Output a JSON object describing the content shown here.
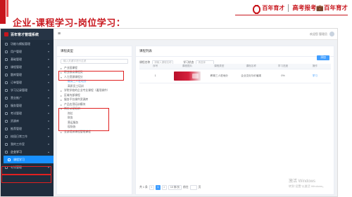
{
  "slide": {
    "title": "企业-课程学习-岗位学习：",
    "brand_name": "百年育才",
    "brand_slogan": "高考报考💼百年育才"
  },
  "app": {
    "title": "百年育才管理系统",
    "user_text": "欢迎您 管理员"
  },
  "sidebar": {
    "items": [
      {
        "label": "功能与模板管理"
      },
      {
        "label": "用户管理"
      },
      {
        "label": "基础管理"
      },
      {
        "label": "课程管理"
      },
      {
        "label": "题库管理"
      },
      {
        "label": "订单管理"
      },
      {
        "label": "学习记录管理"
      },
      {
        "label": "营业推广"
      },
      {
        "label": "服务管理"
      },
      {
        "label": "考试管理"
      },
      {
        "label": "资源库"
      },
      {
        "label": "推荐管理"
      },
      {
        "label": "校园日常工作"
      },
      {
        "label": "我的工作室"
      },
      {
        "label": "企业学习"
      },
      {
        "label": "课程学习"
      },
      {
        "label": "考试管理"
      }
    ]
  },
  "left_panel": {
    "title": "课程类型",
    "search_placeholder": "输入关键字进行过滤",
    "nodes": [
      {
        "label": "产业园课程",
        "level": 1,
        "caret": "▸"
      },
      {
        "label": "职业教育课程类",
        "level": 1,
        "caret": "▸"
      },
      {
        "label": "人力资源课程分",
        "level": 1,
        "caret": "▾"
      },
      {
        "label": "教育三人驻地分",
        "level": 2,
        "caret": ""
      },
      {
        "label": "高质员工培训",
        "level": 2,
        "caret": ""
      },
      {
        "label": "学院学校的企业专业课程（通用课件）",
        "level": 1,
        "caret": "▸"
      },
      {
        "label": "区域内部课程",
        "level": 1,
        "caret": "▸"
      },
      {
        "label": "服务平台课件资源库",
        "level": 1,
        "caret": "▸"
      },
      {
        "label": "产品应用培训模块",
        "level": 1,
        "caret": "▸"
      },
      {
        "label": "岗位认证培训",
        "level": 1,
        "caret": "▾"
      },
      {
        "label": "岗位",
        "level": 2,
        "caret": ""
      },
      {
        "label": "财务",
        "level": 2,
        "caret": ""
      },
      {
        "label": "营运服务",
        "level": 2,
        "caret": ""
      },
      {
        "label": "现场协",
        "level": 2,
        "caret": ""
      },
      {
        "label": "全部培训课程管理课程",
        "level": 1,
        "caret": "▸"
      }
    ]
  },
  "right_panel": {
    "title": "课程列表",
    "filter_name_label": "课程名称",
    "filter_name_placeholder": "请输入课程名称",
    "filter_status_label": "学习状态",
    "filter_status_placeholder": "请选择",
    "add_button": "添加",
    "columns": [
      "序号",
      "课程图片",
      "课程类型",
      "课程名称",
      "学习进度",
      "操作"
    ],
    "rows": [
      {
        "index": "1",
        "type": "教育三人驻地分",
        "name": "企业文化与价值观",
        "progress": "0%",
        "action": "学习"
      }
    ]
  },
  "pager": {
    "total": "共 1 条",
    "prev": "<",
    "pages": [
      "1"
    ],
    "next": ">",
    "size": "10 条/页",
    "goto_label": "前往",
    "page_unit": "页"
  },
  "watermark": {
    "line1": "激活 Windows",
    "line2": "转到“设置”以激活 Windows。"
  },
  "colors": {
    "brand_red": "#c8161d",
    "sidebar_bg": "#1f2d3d",
    "accent_blue": "#409eff",
    "highlight_red": "#e02020"
  }
}
